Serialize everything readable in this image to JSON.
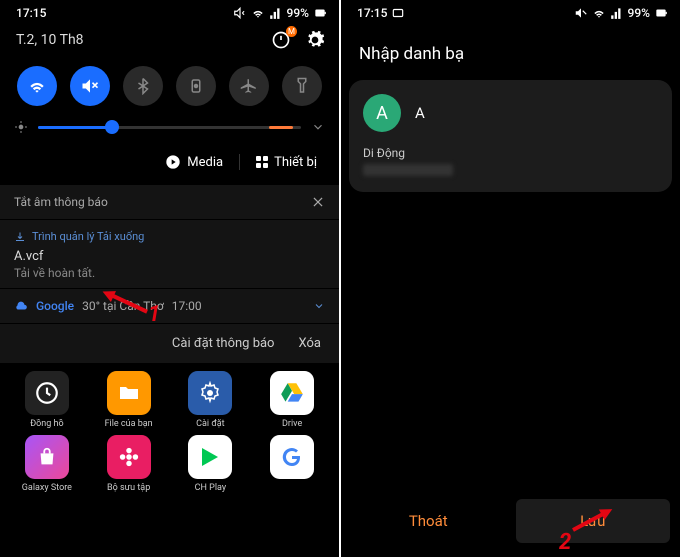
{
  "left": {
    "status": {
      "time": "17:15",
      "battery": "99%"
    },
    "date": "T.2, 10 Th8",
    "media_label": "Media",
    "devices_label": "Thiết bị",
    "mute_heading": "Tắt âm thông báo",
    "download": {
      "app": "Trình quản lý Tải xuống",
      "file": "A.vcf",
      "status": "Tải về hoàn tất."
    },
    "weather": {
      "source": "Google",
      "text": "30° tại Cần Thơ",
      "time": "17:00"
    },
    "actions": {
      "settings": "Cài đặt thông báo",
      "clear": "Xóa"
    },
    "apps_row1": [
      "Đồng hồ",
      "File của bạn",
      "Cài đặt",
      "Drive"
    ],
    "apps_row2": [
      "Galaxy Store",
      "Bộ sưu tập",
      "CH Play",
      ""
    ]
  },
  "right": {
    "status": {
      "time": "17:15",
      "battery": "99%"
    },
    "title": "Nhập danh bạ",
    "contact": {
      "initial": "A",
      "name": "A",
      "field_label": "Di Động"
    },
    "buttons": {
      "cancel": "Thoát",
      "save": "Lưu"
    }
  },
  "callouts": {
    "one": "1",
    "two": "2"
  }
}
